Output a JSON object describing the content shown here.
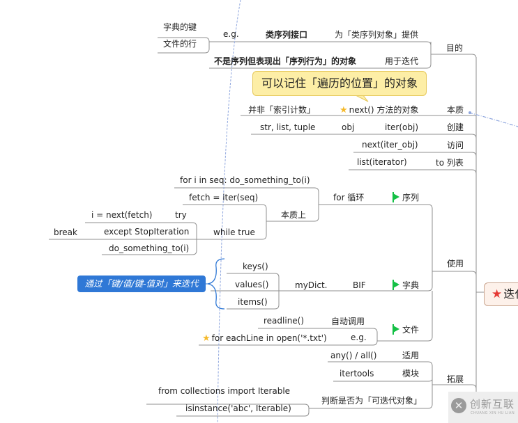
{
  "root": {
    "label": "迭代器",
    "icon": "red-star"
  },
  "branches": {
    "purpose": {
      "label": "目的",
      "provides": "为「类序列对象」提供",
      "interface": "类序列接口",
      "eg": "e.g.",
      "examples": [
        "字典的键",
        "文件的行"
      ],
      "for_iteration": "用于迭代",
      "non_sequence": "不是序列但表现出「序列行为」的对象"
    },
    "essence": {
      "label": "本质",
      "callout": "可以记住「遍历的位置」的对象",
      "next_method": "next() 方法的对象",
      "not_index": "并非「索引计数」"
    },
    "create": {
      "label": "创建",
      "func": "iter(obj)",
      "obj": "obj",
      "types": "str, list, tuple"
    },
    "access": {
      "label": "访问",
      "func": "next(iter_obj)"
    },
    "to_list": {
      "label": "to 列表",
      "func": "list(iterator)"
    },
    "use": {
      "label": "使用",
      "sequence": {
        "label": "序列",
        "for_loop": "for 循环",
        "for_stmt": "for i in seq: do_something_to(i)",
        "essentially": "本质上",
        "fetch": "fetch = iter(seq)",
        "while_true": "while true",
        "try": "try",
        "next_fetch": "i = next(fetch)",
        "except": "except StopIteration",
        "break": "break",
        "do_something": "do_something_to(i)"
      },
      "dict": {
        "label": "字典",
        "bif": "BIF",
        "mydict": "myDict.",
        "methods": [
          "keys()",
          "values()",
          "items()"
        ],
        "note": "通过「键/值/键-值对」来迭代"
      },
      "file": {
        "label": "文件",
        "auto_call": "自动调用",
        "readline": "readline()",
        "eg": "e.g.",
        "for_each": "for eachLine in open('*.txt')"
      }
    },
    "extend": {
      "label": "拓展",
      "apply": "适用",
      "any_all": "any() / all()",
      "module": "模块",
      "itertools": "itertools",
      "check": "判断是否为「可迭代对象」",
      "import": "from collections import Iterable",
      "isinstance": "isinstance('abc', Iterable)"
    }
  },
  "watermark": {
    "cn": "创新互联",
    "en": "CHUANG XIN HU LIAN"
  },
  "colors": {
    "flag": "#14c045",
    "callout_bg": "#fdeea6",
    "note_bg": "#2f78d6",
    "root_star": "#e53935",
    "line": "#8a8a8a"
  }
}
